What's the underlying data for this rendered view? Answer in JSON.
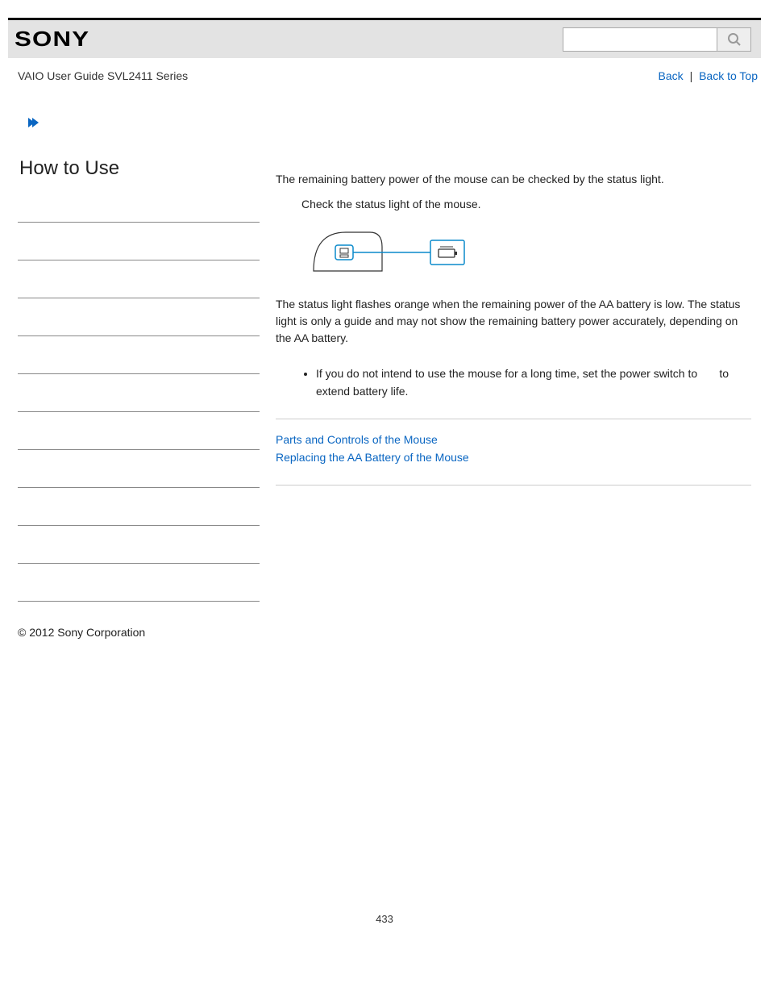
{
  "header": {
    "logo_text": "SONY",
    "search_placeholder": ""
  },
  "subheader": {
    "guide_title": "VAIO User Guide SVL2411 Series",
    "back_label": "Back",
    "back_to_top_label": "Back to Top",
    "separator": "|"
  },
  "sidebar": {
    "heading": "How to Use",
    "item_count": 11
  },
  "main": {
    "intro": "The remaining battery power of the mouse can be checked by the status light.",
    "step": "Check the status light of the mouse.",
    "status_text": "The status light flashes orange when the remaining power of the AA battery is low. The status light is only a guide and may not show the remaining battery power accurately, depending on the AA battery.",
    "hint_prefix": "If you do not intend to use the mouse for a long time, set the power switch to ",
    "hint_suffix": " to extend battery life.",
    "related": [
      "Parts and Controls of the Mouse",
      "Replacing the AA Battery of the Mouse"
    ]
  },
  "footer": {
    "copyright": "© 2012 Sony Corporation",
    "page_number": "433"
  }
}
